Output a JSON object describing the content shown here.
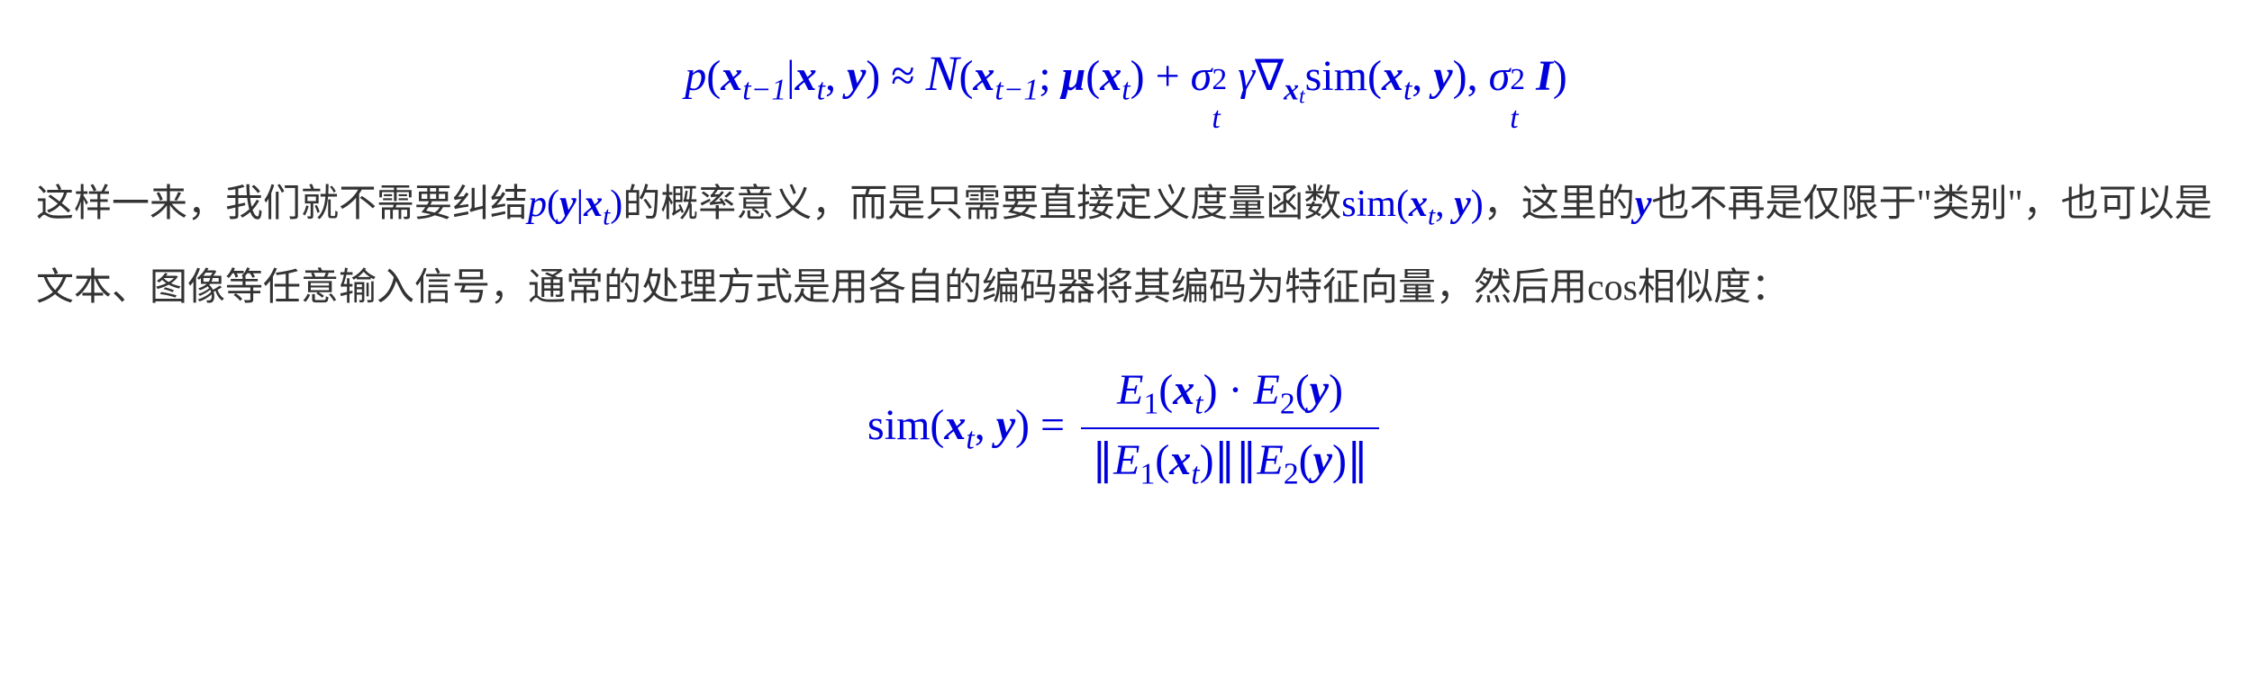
{
  "equation1": {
    "full_latex": "p(x_{t-1} | x_t, y) ≈ N(x_{t-1}; μ(x_t) + σ_t^2 γ ∇_{x_t} sim(x_t, y), σ_t^2 I)",
    "lhs_p": "p",
    "lparen": "(",
    "x": "x",
    "t_minus_1": "t−1",
    "bar": "|",
    "t": "t",
    "comma": ",",
    "y": "y",
    "rparen": ")",
    "approx": " ≈ ",
    "N": "N",
    "semicolon": ";",
    "mu": "μ",
    "plus": " + ",
    "sigma": "σ",
    "two": "2",
    "gamma": "γ",
    "nabla": "∇",
    "sim": "sim",
    "I": "I"
  },
  "prose": {
    "part1": "这样一来，我们就不需要纠结",
    "inline1_p": "p",
    "inline1_lp": "(",
    "inline1_y": "y",
    "inline1_bar": "|",
    "inline1_x": "x",
    "inline1_t": "t",
    "inline1_rp": ")",
    "part2": "的概率意义，而是只需要直接定义度量函数",
    "inline2_sim": "sim",
    "inline2_lp": "(",
    "inline2_x": "x",
    "inline2_t": "t",
    "inline2_comma": ",",
    "inline2_y": "y",
    "inline2_rp": ")",
    "part3": "，这里的",
    "inline3_y": "y",
    "part4": "也不再是仅限于\"类别\"，也可以是文本、图像等任意输入信号，通常的处理方式是用各自的编码器将其编码为特征向量，然后用cos相似度："
  },
  "equation2": {
    "full_latex": "sim(x_t, y) = (E_1(x_t) · E_2(y)) / (||E_1(x_t)|| ||E_2(y)||)",
    "sim": "sim",
    "lp": "(",
    "x": "x",
    "t": "t",
    "comma": ",",
    "y": "y",
    "rp": ")",
    "eq": " = ",
    "E": "E",
    "one": "1",
    "two": "2",
    "cdot": " · ",
    "dbar": "∥"
  },
  "chart_data": {
    "type": "equation",
    "note": "This is a mathematical text segment from a paper on diffusion models, showing (1) the approximation of the reverse conditional distribution p(x_{t-1}|x_t,y) as a Gaussian with mean shifted by the gradient of a similarity score, and (2) the cosine-similarity definition of sim(x_t,y) using two encoders E_1 and E_2."
  }
}
